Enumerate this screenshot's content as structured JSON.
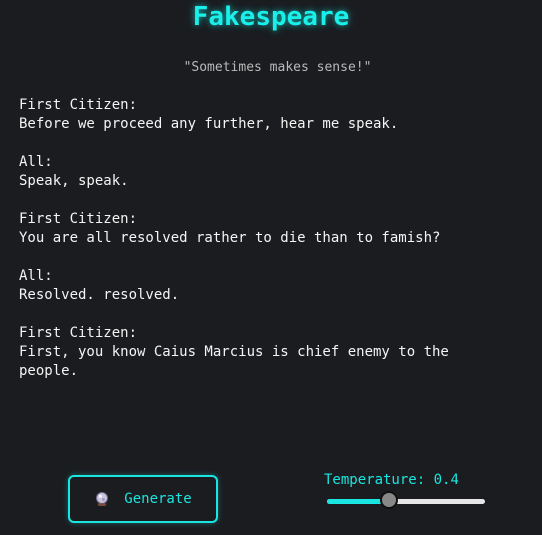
{
  "app": {
    "title": "Fakespeare",
    "subtitle": "\"Sometimes makes sense!\""
  },
  "output": {
    "blocks": [
      {
        "lines": [
          "First Citizen:",
          "Before we proceed any further, hear me speak."
        ]
      },
      {
        "lines": [
          "All:",
          "Speak, speak."
        ]
      },
      {
        "lines": [
          "First Citizen:",
          "You are all resolved rather to die than to famish?"
        ]
      },
      {
        "lines": [
          "All:",
          "Resolved. resolved."
        ]
      },
      {
        "lines": [
          "First Citizen:",
          "First, you know Caius Marcius is chief enemy to the",
          "people."
        ]
      }
    ]
  },
  "controls": {
    "generate_label": "Generate",
    "generate_icon": "crystal-ball-icon",
    "temperature_label": "Temperature:",
    "temperature_value": "0.4",
    "temperature_fraction": 0.4
  },
  "colors": {
    "background": "#1b1c20",
    "accent": "#19e6e0",
    "text": "#f4f4f4",
    "subtitle": "#b9b9b9"
  }
}
